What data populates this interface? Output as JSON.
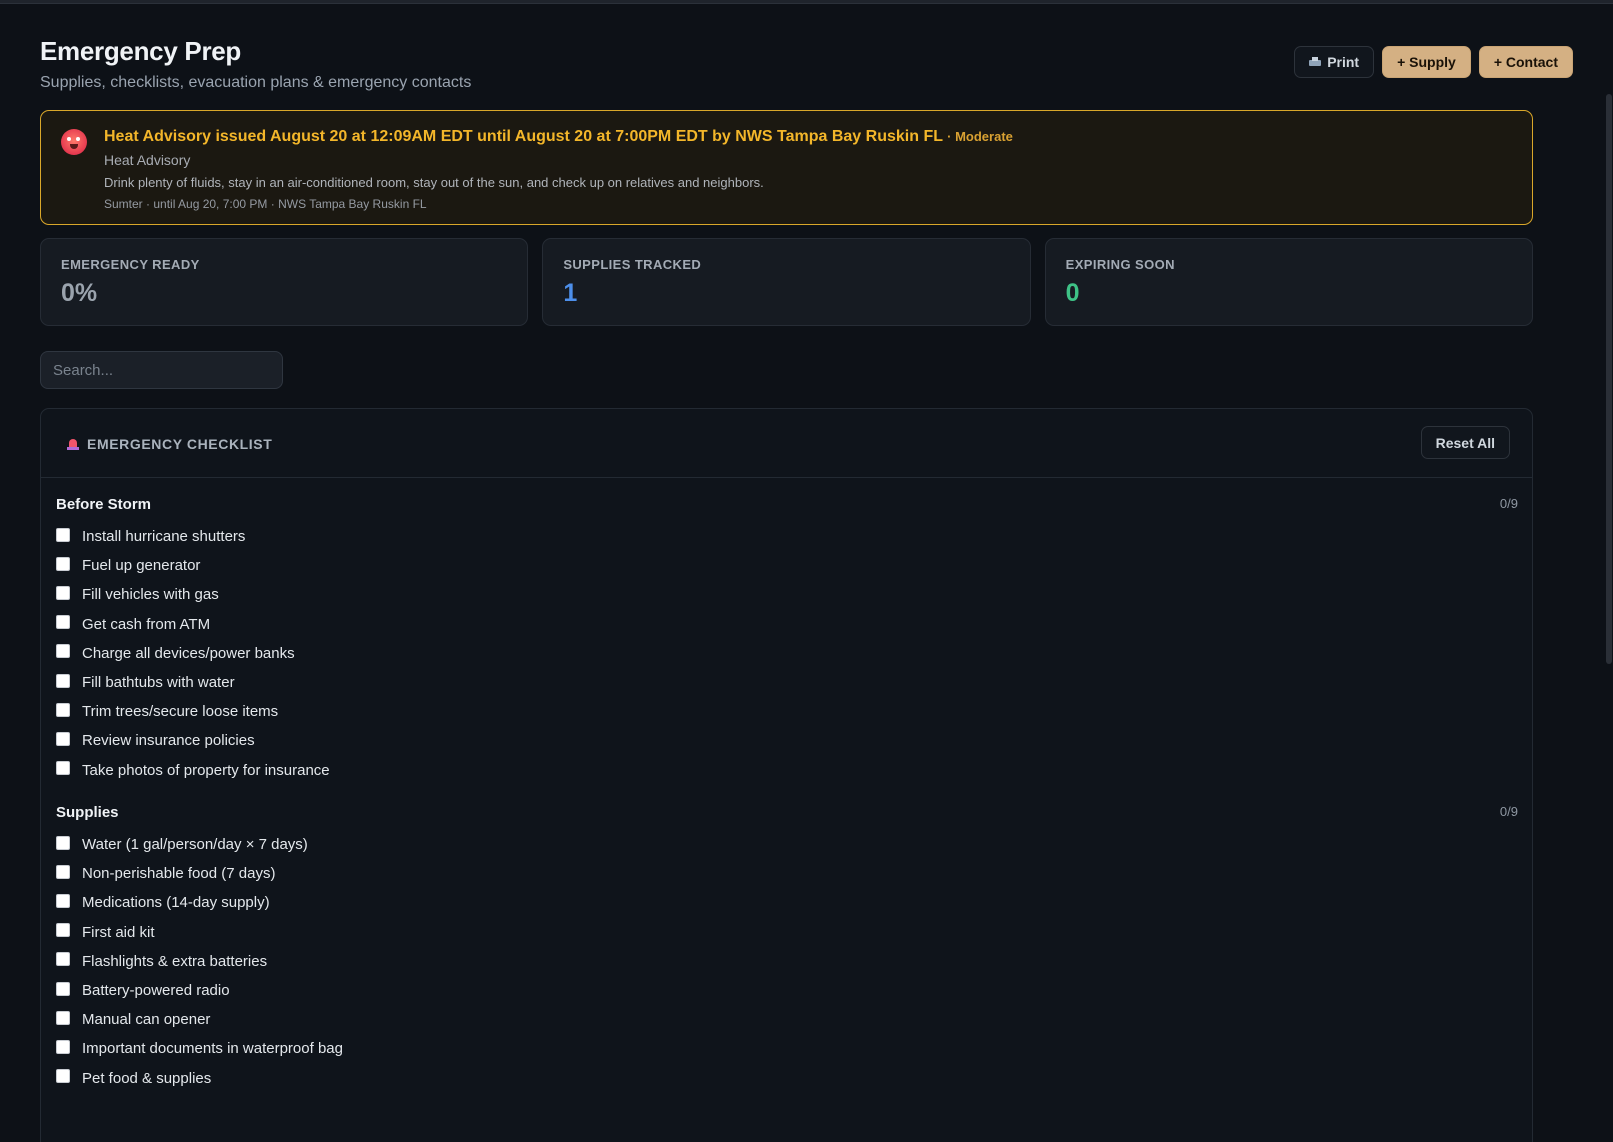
{
  "header": {
    "title": "Emergency Prep",
    "subtitle": "Supplies, checklists, evacuation plans & emergency contacts",
    "print_label": "Print",
    "add_supply_label": "+ Supply",
    "add_contact_label": "+ Contact"
  },
  "alert": {
    "title": "Heat Advisory issued August 20 at 12:09AM EDT until August 20 at 7:00PM EDT by NWS Tampa Bay Ruskin FL",
    "severity": "· Moderate",
    "event": "Heat Advisory",
    "description": "Drink plenty of fluids, stay in an air-conditioned room, stay out of the sun, and check up on relatives and neighbors.",
    "meta": "Sumter · until Aug 20, 7:00 PM · NWS Tampa Bay Ruskin FL"
  },
  "stats": [
    {
      "label": "EMERGENCY READY",
      "value": "0%",
      "color": "#9aa3ad"
    },
    {
      "label": "SUPPLIES TRACKED",
      "value": "1",
      "color": "#4d8fea"
    },
    {
      "label": "EXPIRING SOON",
      "value": "0",
      "color": "#3ec286"
    }
  ],
  "search": {
    "placeholder": "Search..."
  },
  "checklist": {
    "title": "EMERGENCY CHECKLIST",
    "reset_label": "Reset All",
    "groups": [
      {
        "title": "Before Storm",
        "count": "0/9",
        "items": [
          "Install hurricane shutters",
          "Fuel up generator",
          "Fill vehicles with gas",
          "Get cash from ATM",
          "Charge all devices/power banks",
          "Fill bathtubs with water",
          "Trim trees/secure loose items",
          "Review insurance policies",
          "Take photos of property for insurance"
        ]
      },
      {
        "title": "Supplies",
        "count": "0/9",
        "items": [
          "Water (1 gal/person/day × 7 days)",
          "Non-perishable food (7 days)",
          "Medications (14-day supply)",
          "First aid kit",
          "Flashlights & extra batteries",
          "Battery-powered radio",
          "Manual can opener",
          "Important documents in waterproof bag",
          "Pet food & supplies"
        ]
      }
    ]
  }
}
